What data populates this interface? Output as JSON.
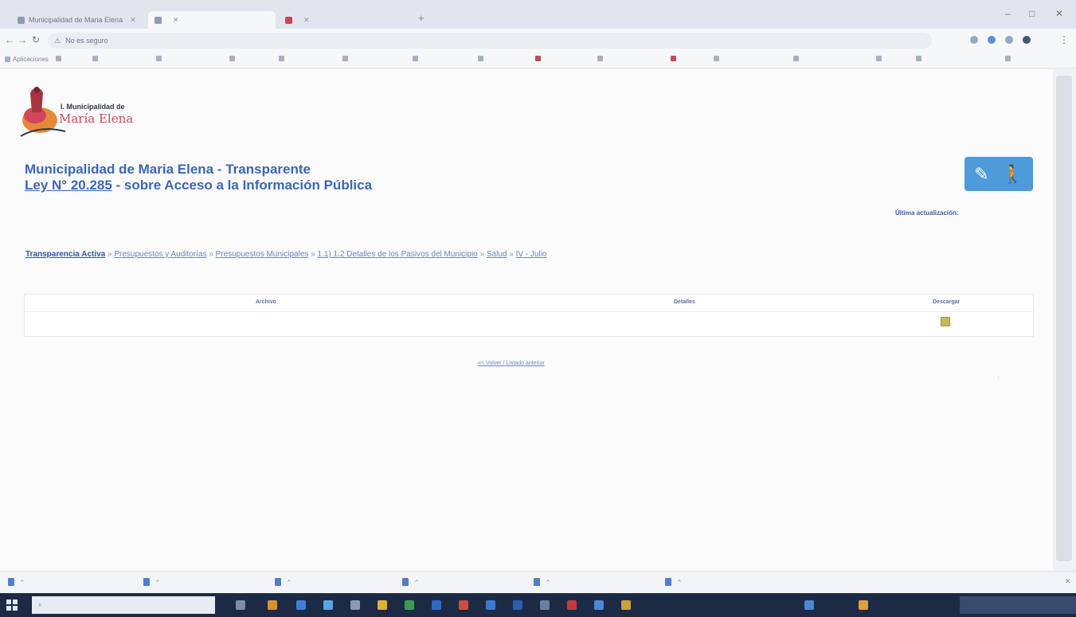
{
  "browser": {
    "tabs": [
      {
        "title": "Municipalidad de Maria Elena",
        "active": false
      },
      {
        "title": "",
        "active": true
      },
      {
        "title": "",
        "active": false
      }
    ],
    "new_tab_glyph": "+",
    "window_controls": [
      "–",
      "□",
      "✕"
    ],
    "omnibox": {
      "security_label": "No es seguro",
      "url": ""
    },
    "bookmarks": [
      "Aplicaciones",
      "",
      "",
      "",
      "",
      "",
      "",
      "",
      "",
      "",
      "",
      "",
      "",
      "",
      "",
      "",
      ""
    ]
  },
  "page": {
    "logo": {
      "line1": "I. Municipalidad de",
      "line2": "María Elena",
      "tagline": ""
    },
    "title_line1": "Municipalidad de Maria Elena - Transparente",
    "title_law_link": "Ley N° 20.285",
    "title_line2_rest": " - sobre Acceso a la Información Pública",
    "accessibility_label": "",
    "updated_label": "Última actualización:",
    "updated_value": "",
    "breadcrumbs": [
      "Transparencia Activa",
      "Presupuestos y Auditorías",
      "Presupuestos Municipales",
      "1.1) 1.2 Detalles de los Pasivos del Municipio",
      "Salud",
      "IV - Julio"
    ],
    "breadcrumb_sep": "»",
    "table": {
      "headers": [
        "Archivo",
        "Detalles",
        "Descargar"
      ],
      "rows": [
        {
          "file": "",
          "details": ""
        }
      ]
    },
    "back_link": "<< Volver / Listado anterior",
    "top_label": "",
    "footer": {
      "lines": [],
      "web_link": "",
      "links_label": "",
      "bottom_label": ""
    }
  },
  "downloads": [
    {
      "name": ""
    },
    {
      "name": ""
    },
    {
      "name": ""
    },
    {
      "name": ""
    },
    {
      "name": ""
    },
    {
      "name": ""
    }
  ],
  "downloads_show_all": "",
  "taskbar": {
    "search_placeholder": "",
    "time": "",
    "date": ""
  }
}
